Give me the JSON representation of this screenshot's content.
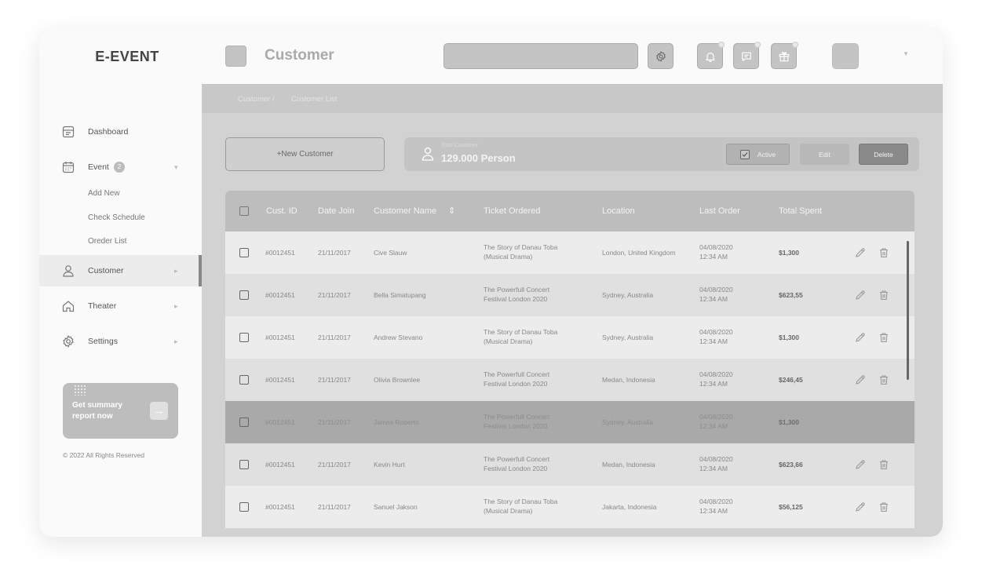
{
  "app": {
    "logo": "E-EVENT"
  },
  "sidebar": {
    "items": [
      {
        "key": "dashboard",
        "label": "Dashboard"
      },
      {
        "key": "event",
        "label": "Event",
        "badge": "2"
      },
      {
        "key": "customer",
        "label": "Customer"
      },
      {
        "key": "theater",
        "label": "Theater"
      },
      {
        "key": "settings",
        "label": "Settings"
      }
    ],
    "event_sub": [
      "Add New",
      "Check Schedule",
      "Oreder List"
    ],
    "summary_card": {
      "text": "Get summary report now",
      "arrow": "→"
    },
    "copyright": "© 2022 All Rights Reserved"
  },
  "header": {
    "title": "Customer",
    "search_placeholder": ""
  },
  "breadcrumb": {
    "parent": "Customer /",
    "current": "Customer List"
  },
  "actions": {
    "new_customer": "+New Customer",
    "total_label": "Total Customer",
    "total_value": "129.000 Person",
    "active": "Active",
    "edit": "Edit",
    "delete": "Delete"
  },
  "table": {
    "columns": [
      "Cust. ID",
      "Date Join",
      "Customer Name",
      "Ticket Ordered",
      "Location",
      "Last Order",
      "Total Spent"
    ],
    "sort_icon": "⇕",
    "rows": [
      {
        "id": "#0012451",
        "date": "21/11/2017",
        "name": "Cive Slauw",
        "ticket1": "The Story of Danau Toba",
        "ticket2": "(Musical Drama)",
        "location": "London, United Kingdom",
        "order_date": "04/08/2020",
        "order_time": "12:34 AM",
        "spent": "$1,300"
      },
      {
        "id": "#0012451",
        "date": "21/11/2017",
        "name": "Bella Simatupang",
        "ticket1": "The Powerfull Concert",
        "ticket2": "Festival London 2020",
        "location": "Sydney, Australia",
        "order_date": "04/08/2020",
        "order_time": "12:34 AM",
        "spent": "$623,55"
      },
      {
        "id": "#0012451",
        "date": "21/11/2017",
        "name": "Andrew Stevano",
        "ticket1": "The Story of Danau Toba",
        "ticket2": "(Musical Drama)",
        "location": "Sydney, Australia",
        "order_date": "04/08/2020",
        "order_time": "12:34 AM",
        "spent": "$1,300"
      },
      {
        "id": "#0012451",
        "date": "21/11/2017",
        "name": "Olivia Brownlee",
        "ticket1": "The Powerfull Concert",
        "ticket2": "Festival London 2020",
        "location": "Medan, Indonesia",
        "order_date": "04/08/2020",
        "order_time": "12:34 AM",
        "spent": "$246,45"
      },
      {
        "id": "#0012451",
        "date": "21/11/2017",
        "name": "James Roberto",
        "ticket1": "The Powerfull Concert",
        "ticket2": "Festival London 2020",
        "location": "Sydney, Australia",
        "order_date": "04/08/2020",
        "order_time": "12:34 AM",
        "spent": "$1,300"
      },
      {
        "id": "#0012451",
        "date": "21/11/2017",
        "name": "Kevin Hurt",
        "ticket1": "The Powerfull Concert",
        "ticket2": "Festival London 2020",
        "location": "Medan, Indonesia",
        "order_date": "04/08/2020",
        "order_time": "12:34 AM",
        "spent": "$623,66"
      },
      {
        "id": "#0012451",
        "date": "21/11/2017",
        "name": "Sanuel Jakson",
        "ticket1": "The Story of Danau Toba",
        "ticket2": "(Musical Drama)",
        "location": "Jakarta, Indonesia",
        "order_date": "04/08/2020",
        "order_time": "12:34 AM",
        "spent": "$56,125"
      }
    ]
  }
}
